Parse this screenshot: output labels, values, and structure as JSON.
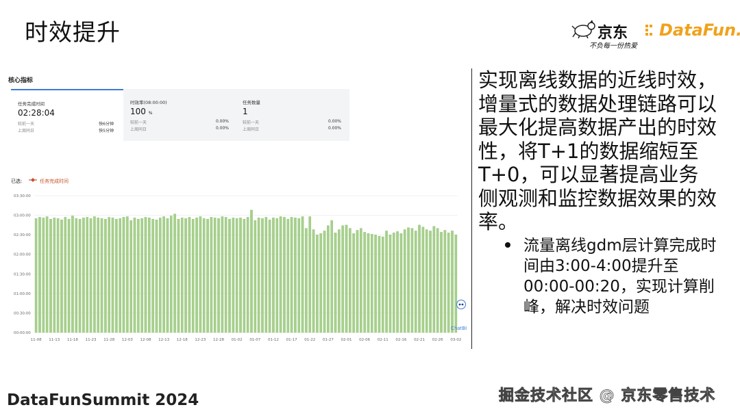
{
  "slide": {
    "title": "时效提升"
  },
  "logos": {
    "jd_text": "京东",
    "jd_slogan": "不负每一份热爱",
    "datafun_text": "DataFun."
  },
  "dashboard": {
    "core_title": "核心指标",
    "cards": [
      {
        "label": "任务完成时间",
        "value": "02:28:04",
        "unit": "",
        "rows": [
          {
            "label": "较前一天",
            "value": "快6分钟"
          },
          {
            "label": "上周同日",
            "value": "快5分钟"
          }
        ]
      },
      {
        "label": "时效率(08:00:00)",
        "value": "100",
        "unit": "%",
        "rows": [
          {
            "label": "较前一天",
            "value": "0.00%"
          },
          {
            "label": "上周同日",
            "value": "0.00%"
          }
        ]
      },
      {
        "label": "任务数量",
        "value": "1",
        "unit": "",
        "rows": [
          {
            "label": "较前一天",
            "value": "0.00%"
          },
          {
            "label": "上周同日",
            "value": "0.00%"
          }
        ]
      }
    ],
    "filter_label": "已选:",
    "filter_item": "任务完成时间",
    "chatbi_label": "ChatBI"
  },
  "chart_data": {
    "type": "bar",
    "title": "",
    "xlabel": "",
    "ylabel": "",
    "series_name": "任务完成时间",
    "y_ticks": [
      "00:00:00",
      "00:30:00",
      "01:00:00",
      "01:30:00",
      "02:00:00",
      "02:30:00",
      "03:00:00",
      "03:30:00"
    ],
    "ylim_minutes": [
      0,
      210
    ],
    "x_tick_labels": [
      "11-08",
      "11-13",
      "11-18",
      "11-23",
      "11-28",
      "12-03",
      "12-08",
      "12-13",
      "12-18",
      "12-23",
      "12-28",
      "01-02",
      "01-07",
      "01-12",
      "01-17",
      "01-22",
      "01-27",
      "02-01",
      "02-06",
      "02-11",
      "02-16",
      "02-21",
      "02-26",
      "03-02"
    ],
    "start_label": "11-08",
    "values_minutes": [
      175,
      177,
      176,
      178,
      174,
      176,
      175,
      173,
      177,
      174,
      179,
      175,
      174,
      176,
      177,
      175,
      178,
      176,
      175,
      174,
      177,
      176,
      174,
      175,
      177,
      178,
      172,
      176,
      174,
      175,
      177,
      176,
      174,
      173,
      176,
      178,
      175,
      179,
      182,
      174,
      176,
      175,
      177,
      174,
      176,
      178,
      175,
      174,
      177,
      176,
      175,
      178,
      177,
      174,
      176,
      175,
      176,
      174,
      177,
      188,
      172,
      176,
      175,
      177,
      173,
      176,
      175,
      178,
      177,
      174,
      177,
      176,
      175,
      178,
      160,
      178,
      158,
      150,
      152,
      156,
      164,
      172,
      153,
      158,
      164,
      165,
      160,
      152,
      157,
      160,
      154,
      152,
      151,
      150,
      148,
      147,
      156,
      150,
      153,
      155,
      152,
      158,
      161,
      160,
      156,
      165,
      162,
      158,
      156,
      163,
      160,
      154,
      157,
      153,
      156,
      150
    ]
  },
  "right_panel": {
    "main_text": "实现离线数据的近线时效，增量式的数据处理链路可以最大化提高数据产出的时效性，将T+1的数据缩短至T+0，可以显著提高业务侧观测和监控数据效果的效率。",
    "bullet": "流量离线gdm层计算完成时间由3:00-4:00提升至00:00-00:20，实现计算削峰，解决时效问题"
  },
  "footer": {
    "left": "DataFunSummit 2024",
    "right": "掘金技术社区 @ 京东零售技术"
  },
  "colors": {
    "bar": "#a8d08d",
    "bar_edge": "#7fb864",
    "accent": "#3a7bd5",
    "filter": "#c8502a",
    "datafun": "#f0a21c"
  }
}
